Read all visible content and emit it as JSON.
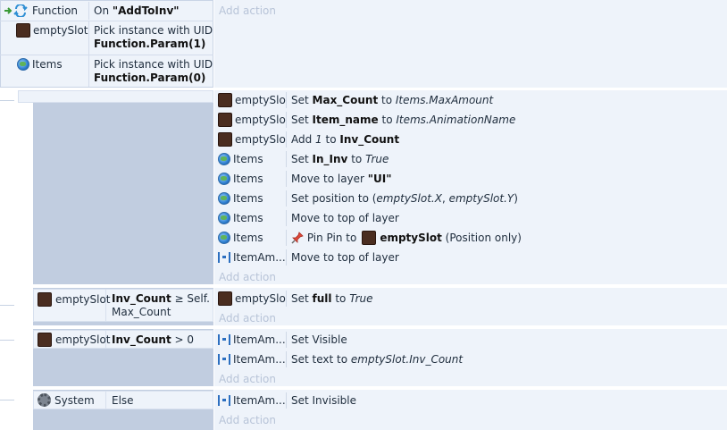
{
  "function_block": {
    "label": "Function",
    "signature_prefix": "On ",
    "signature_name": "\"AddToInv\"",
    "add_action": "Add action",
    "conditions": [
      {
        "object": "emptySlot",
        "icon": "sprite-icon",
        "line1": "Pick instance with UID",
        "line2": "Function.Param(1)"
      },
      {
        "object": "Items",
        "icon": "globe-icon",
        "line1": "Pick instance with UID",
        "line2": "Function.Param(0)"
      }
    ]
  },
  "sub_event_1": {
    "actions": [
      {
        "object": "emptySlot",
        "icon": "sprite-icon",
        "parts": [
          [
            "t",
            "Set "
          ],
          [
            "b",
            "Max_Count"
          ],
          [
            "t",
            " to "
          ],
          [
            "i",
            "Items.MaxAmount"
          ]
        ]
      },
      {
        "object": "emptySlot",
        "icon": "sprite-icon",
        "parts": [
          [
            "t",
            "Set "
          ],
          [
            "b",
            "Item_name"
          ],
          [
            "t",
            " to "
          ],
          [
            "i",
            "Items.AnimationName"
          ]
        ]
      },
      {
        "object": "emptySlot",
        "icon": "sprite-icon",
        "parts": [
          [
            "t",
            "Add "
          ],
          [
            "i",
            "1"
          ],
          [
            "t",
            " to "
          ],
          [
            "b",
            "Inv_Count"
          ]
        ]
      },
      {
        "object": "Items",
        "icon": "globe-icon",
        "parts": [
          [
            "t",
            "Set "
          ],
          [
            "b",
            "In_Inv"
          ],
          [
            "t",
            " to "
          ],
          [
            "i",
            "True"
          ]
        ]
      },
      {
        "object": "Items",
        "icon": "globe-icon",
        "parts": [
          [
            "t",
            "Move to layer "
          ],
          [
            "b",
            "\"UI\""
          ]
        ]
      },
      {
        "object": "Items",
        "icon": "globe-icon",
        "parts": [
          [
            "t",
            "Set position to ("
          ],
          [
            "i",
            "emptySlot.X"
          ],
          [
            "t",
            ", "
          ],
          [
            "i",
            "emptySlot.Y"
          ],
          [
            "t",
            ")"
          ]
        ]
      },
      {
        "object": "Items",
        "icon": "globe-icon",
        "parts": [
          [
            "t",
            "Move to top of layer"
          ]
        ]
      },
      {
        "object": "Items",
        "icon": "globe-icon",
        "parts": [
          [
            "pin",
            ""
          ],
          [
            "t",
            " Pin Pin to "
          ],
          [
            "sprite",
            ""
          ],
          [
            "b",
            " emptySlot"
          ],
          [
            "t",
            " (Position only)"
          ]
        ]
      },
      {
        "object": "ItemAm...",
        "icon": "text-icon",
        "parts": [
          [
            "t",
            "Move to top of layer"
          ]
        ]
      }
    ],
    "add_action": "Add action"
  },
  "sub_event_2": {
    "condition": {
      "object": "emptySlot",
      "icon": "sprite-icon",
      "line1_bold": "Inv_Count",
      "line1_rest": " ≥ Self.",
      "line2": "Max_Count"
    },
    "actions": [
      {
        "object": "emptySlot",
        "icon": "sprite-icon",
        "parts": [
          [
            "t",
            "Set "
          ],
          [
            "b",
            "full"
          ],
          [
            "t",
            " to "
          ],
          [
            "i",
            "True"
          ]
        ]
      }
    ],
    "add_action": "Add action"
  },
  "sub_event_3": {
    "condition": {
      "object": "emptySlot",
      "icon": "sprite-icon",
      "line1_bold": "Inv_Count",
      "line1_rest": " > 0"
    },
    "actions": [
      {
        "object": "ItemAm...",
        "icon": "text-icon",
        "parts": [
          [
            "t",
            "Set Visible"
          ]
        ]
      },
      {
        "object": "ItemAm...",
        "icon": "text-icon",
        "parts": [
          [
            "t",
            "Set text to "
          ],
          [
            "i",
            "emptySlot.Inv_Count"
          ]
        ]
      }
    ],
    "add_action": "Add action"
  },
  "sub_event_4": {
    "condition": {
      "object": "System",
      "icon": "gear-icon",
      "text": "Else"
    },
    "actions": [
      {
        "object": "ItemAm...",
        "icon": "text-icon",
        "parts": [
          [
            "t",
            "Set Invisible"
          ]
        ]
      }
    ],
    "add_action": "Add action"
  }
}
